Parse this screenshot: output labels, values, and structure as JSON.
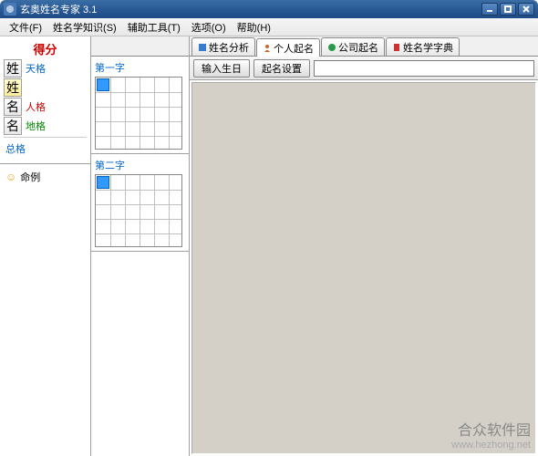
{
  "window": {
    "title": "玄奥姓名专家 3.1"
  },
  "menu": {
    "file": "文件(F)",
    "knowledge": "姓名学知识(S)",
    "tools": "辅助工具(T)",
    "options": "选项(O)",
    "help": "帮助(H)"
  },
  "score": {
    "header": "得分",
    "chars": [
      "姓",
      "姓",
      "名",
      "名"
    ],
    "labels": [
      "天格",
      "人格",
      "地格"
    ],
    "total": "总格"
  },
  "tree": {
    "item1": "命例"
  },
  "charboxes": {
    "first": "第一字",
    "second": "第二字"
  },
  "tabs": {
    "analysis": "姓名分析",
    "personal": "个人起名",
    "company": "公司起名",
    "dictionary": "姓名学字典"
  },
  "toolbar": {
    "input_bday": "输入生日",
    "settings": "起名设置",
    "search_value": ""
  },
  "watermark": {
    "main": "合众软件园",
    "sub": "www.hezhong.net"
  }
}
